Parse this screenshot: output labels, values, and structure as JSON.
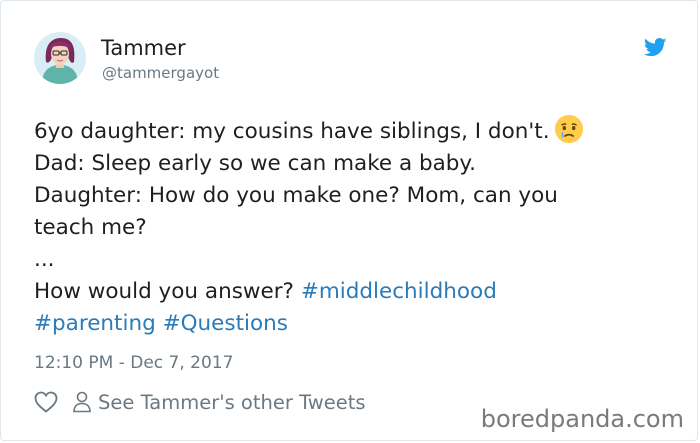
{
  "author": {
    "display_name": "Tammer",
    "handle": "@tammergayot"
  },
  "icons": {
    "avatar": "avatar-illustration",
    "brand": "twitter-bird-icon",
    "like": "heart-icon",
    "profile": "person-icon",
    "emoji": "crying-face-emoji"
  },
  "tweet": {
    "lines": [
      "6yo daughter: my cousins have siblings, I don't.",
      "Dad: Sleep early so we can make a baby.",
      "Daughter: How do you make one? Mom, can you",
      "teach me?",
      "...",
      "How would you answer?"
    ],
    "hashtags": [
      "#middlechildhood",
      "#parenting",
      "#Questions"
    ]
  },
  "timestamp": "12:10 PM - Dec 7, 2017",
  "actions": {
    "see_other_tweets": "See Tammer's other Tweets"
  },
  "watermark": "boredpanda.com",
  "colors": {
    "brand_blue": "#1da1f2",
    "link_blue": "#2b7bb9",
    "secondary_text": "#697882",
    "primary_text": "#1c2022"
  }
}
